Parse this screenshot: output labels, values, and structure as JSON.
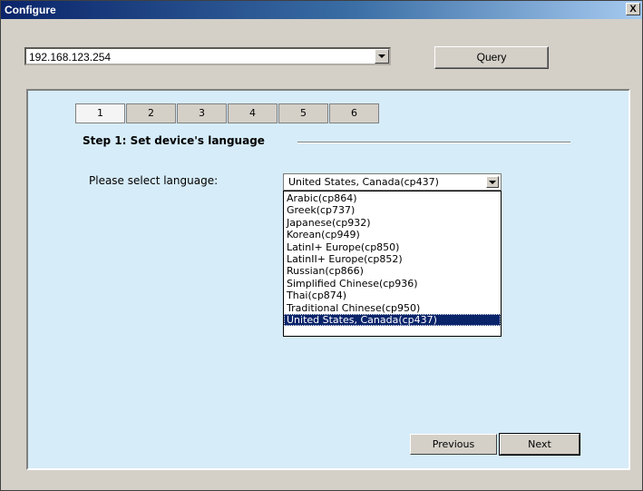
{
  "window": {
    "title": "Configure",
    "close_label": "X"
  },
  "device": {
    "ip": "192.168.123.254",
    "query_label": "Query"
  },
  "tabs": [
    {
      "label": "1"
    },
    {
      "label": "2"
    },
    {
      "label": "3"
    },
    {
      "label": "4"
    },
    {
      "label": "5"
    },
    {
      "label": "6"
    }
  ],
  "step": {
    "title": "Step 1: Set device's language"
  },
  "language": {
    "label": "Please select language:",
    "selected": "United States, Canada(cp437)",
    "options": [
      "Arabic(cp864)",
      "Greek(cp737)",
      "Japanese(cp932)",
      "Korean(cp949)",
      "LatinI+ Europe(cp850)",
      "LatinII+ Europe(cp852)",
      "Russian(cp866)",
      "Simplified Chinese(cp936)",
      "Thai(cp874)",
      "Traditional Chinese(cp950)",
      "United States, Canada(cp437)"
    ]
  },
  "nav": {
    "previous_label": "Previous",
    "next_label": "Next"
  },
  "colors": {
    "title_start": "#0a246a",
    "title_end": "#a6caf0",
    "panel_bg": "#d6ecf8",
    "selection": "#0a246a"
  }
}
